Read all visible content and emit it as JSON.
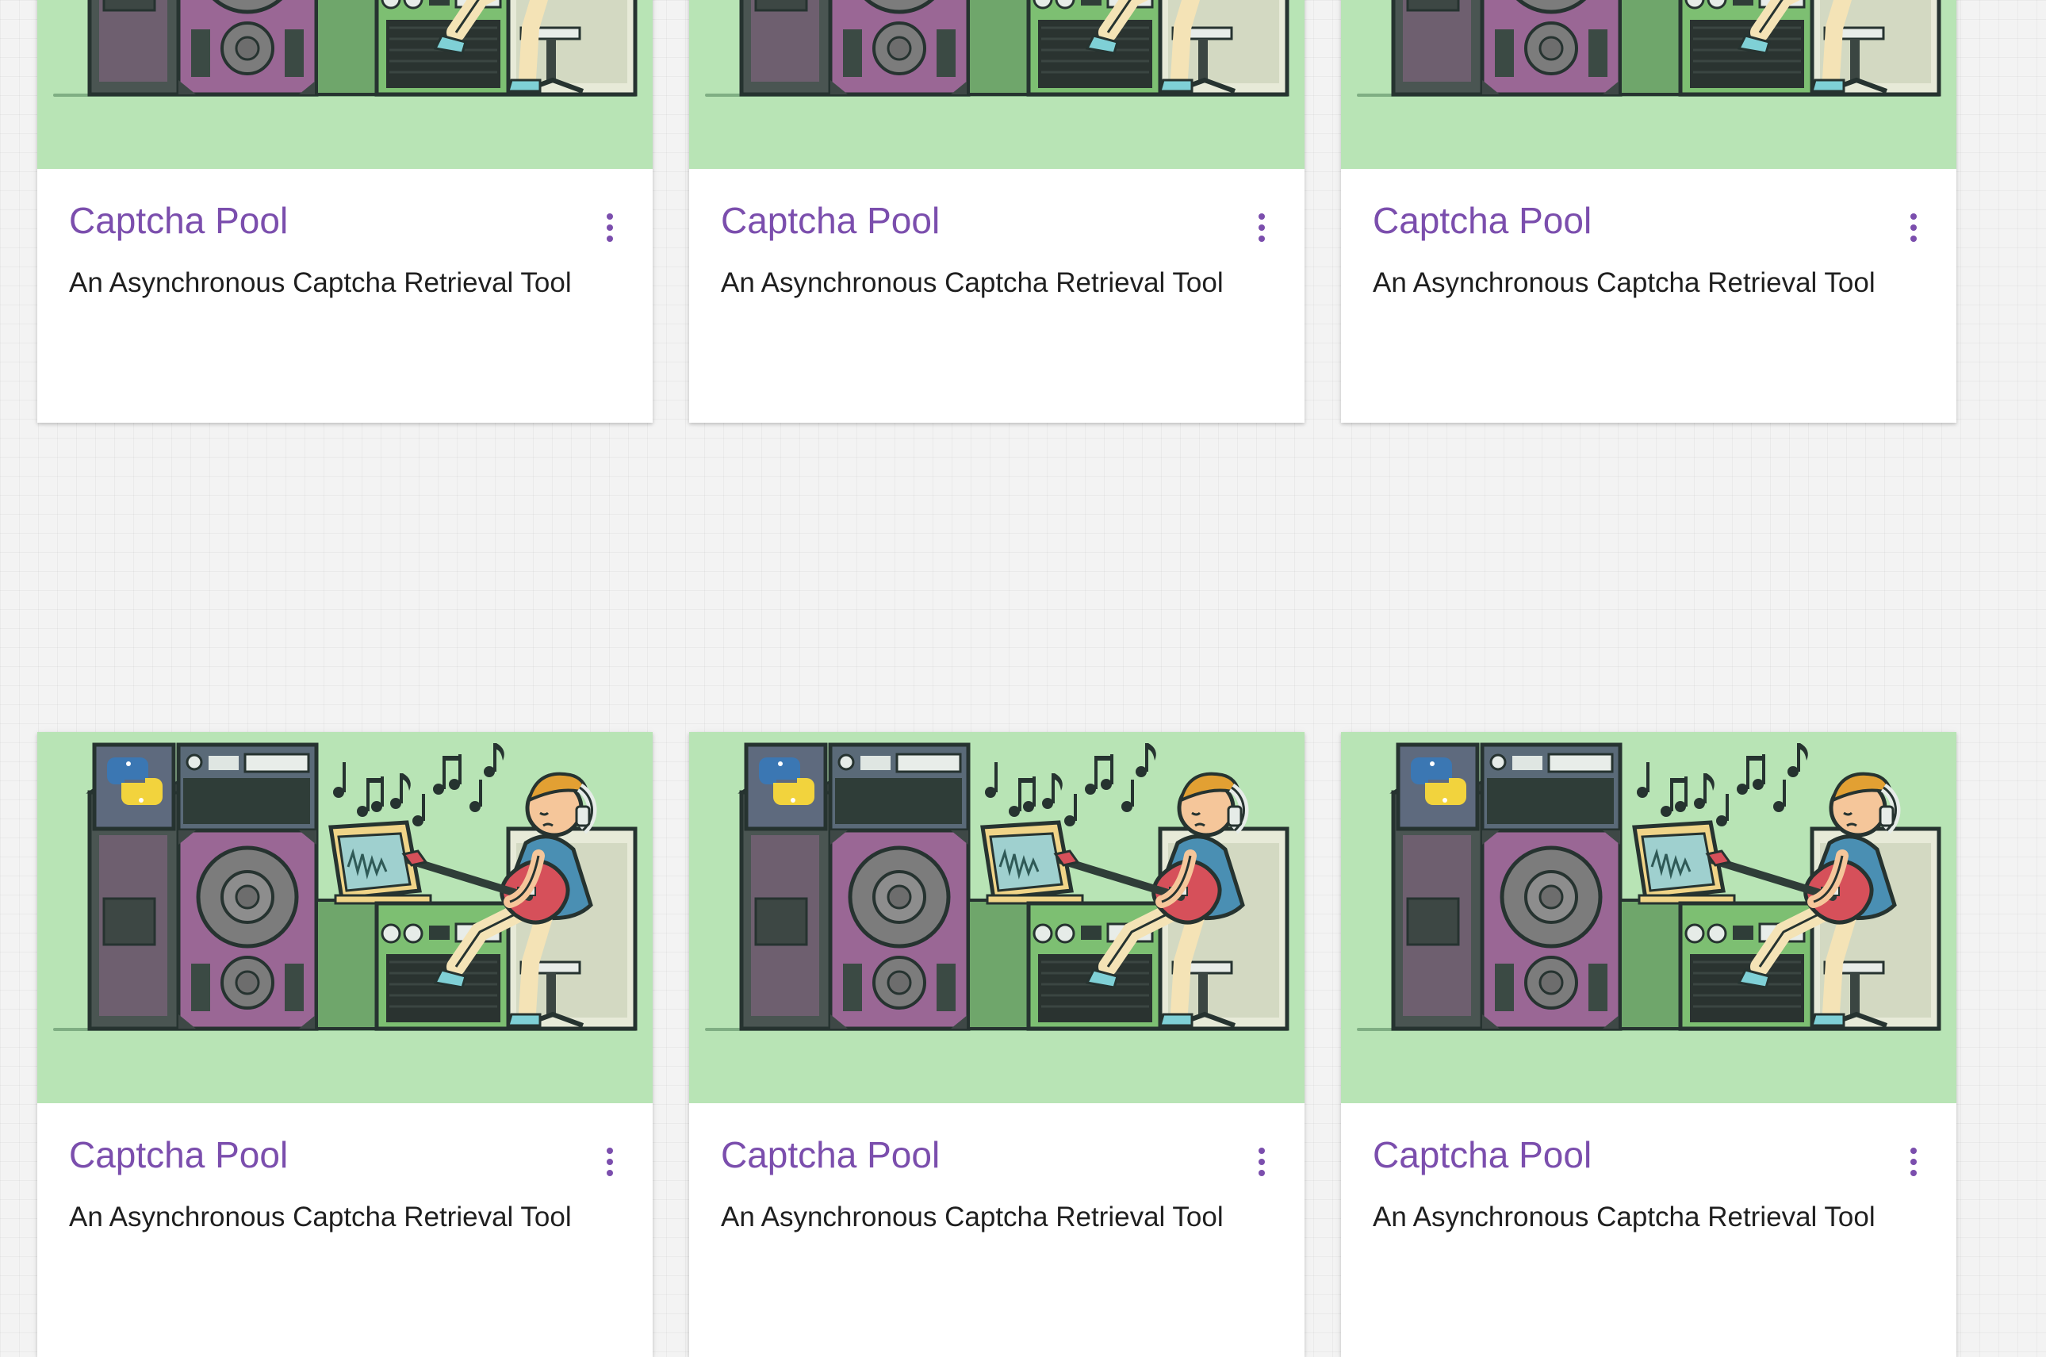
{
  "colors": {
    "page_background": "#f3f3f3",
    "card_background": "#ffffff",
    "media_background": "#b8e4b5",
    "title_accent": "#7b4ead",
    "subtitle_text": "#1f1f1f"
  },
  "cards": [
    {
      "title": "Captcha Pool",
      "subtitle": "An Asynchronous Captcha Retrieval Tool",
      "image_icon": "music-studio-illustration",
      "menu_icon": "more-vert-icon"
    },
    {
      "title": "Captcha Pool",
      "subtitle": "An Asynchronous Captcha Retrieval Tool",
      "image_icon": "music-studio-illustration",
      "menu_icon": "more-vert-icon"
    },
    {
      "title": "Captcha Pool",
      "subtitle": "An Asynchronous Captcha Retrieval Tool",
      "image_icon": "music-studio-illustration",
      "menu_icon": "more-vert-icon"
    },
    {
      "title": "Captcha Pool",
      "subtitle": "An Asynchronous Captcha Retrieval Tool",
      "image_icon": "music-studio-illustration",
      "menu_icon": "more-vert-icon"
    },
    {
      "title": "Captcha Pool",
      "subtitle": "An Asynchronous Captcha Retrieval Tool",
      "image_icon": "music-studio-illustration",
      "menu_icon": "more-vert-icon"
    },
    {
      "title": "Captcha Pool",
      "subtitle": "An Asynchronous Captcha Retrieval Tool",
      "image_icon": "music-studio-illustration",
      "menu_icon": "more-vert-icon"
    }
  ]
}
